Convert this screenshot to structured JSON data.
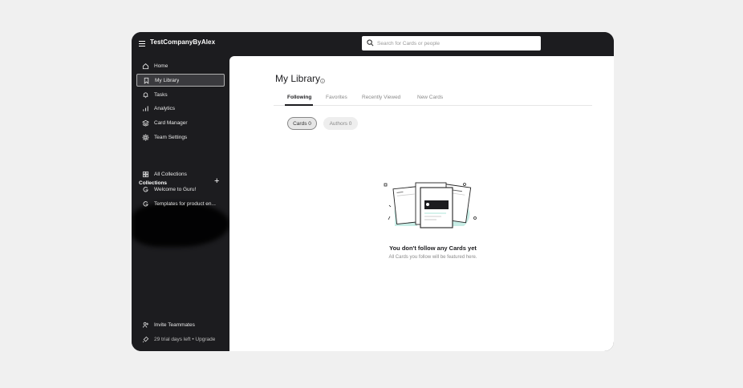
{
  "header": {
    "company": "TestCompanyByAlex",
    "search_placeholder": "Search for Cards or people"
  },
  "sidebar": {
    "items": [
      {
        "label": "Home",
        "icon": "home-icon"
      },
      {
        "label": "My Library",
        "icon": "bookmark-icon",
        "active": true
      },
      {
        "label": "Tasks",
        "icon": "bell-icon"
      },
      {
        "label": "Analytics",
        "icon": "bar-chart-icon"
      },
      {
        "label": "Card Manager",
        "icon": "layers-icon"
      },
      {
        "label": "Team Settings",
        "icon": "gear-icon"
      }
    ],
    "collections_heading": "Collections",
    "add_label": "+",
    "collections": [
      {
        "label": "All Collections",
        "icon": "grid-icon"
      },
      {
        "label": "Welcome to Guru!",
        "icon": "guru-icon"
      },
      {
        "label": "Templates for product en...",
        "icon": "guru-icon"
      }
    ],
    "footer": [
      {
        "label": "Invite Teammates",
        "icon": "add-user-icon"
      },
      {
        "label": "29 trial days left • Upgrade",
        "icon": "rocket-icon"
      }
    ]
  },
  "main": {
    "title": "My Library",
    "tabs": [
      "Following",
      "Favorites",
      "Recently Viewed",
      "New Cards"
    ],
    "filters": [
      "Cards 0",
      "Authors 0"
    ],
    "empty_title": "You don't follow any Cards yet",
    "empty_subtitle": "All Cards you follow will be featured here."
  },
  "colors": {
    "sidebar_bg": "#1c1c1f",
    "page_bg": "#f0f0f0",
    "accent_mint": "#c8ede6"
  }
}
